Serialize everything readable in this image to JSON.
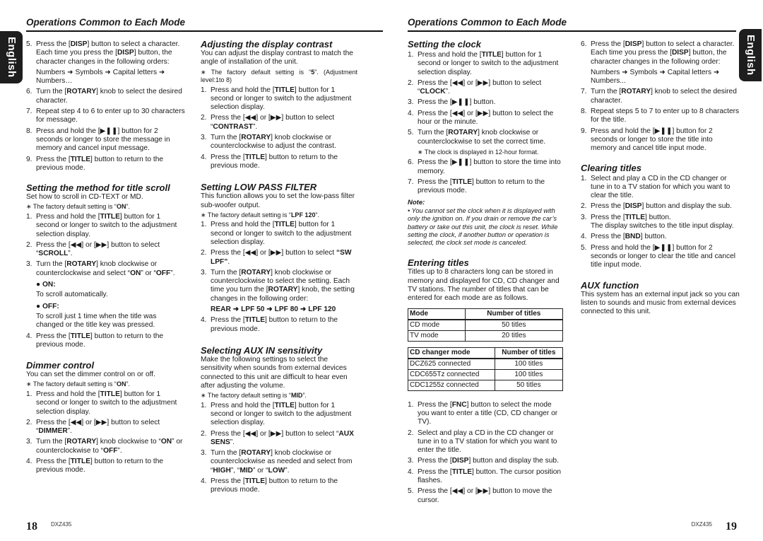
{
  "language_tab": "English",
  "header": {
    "left_title": "Operations Common to Each Mode",
    "right_title": "Operations Common to Each Mode"
  },
  "footer": {
    "left_page": "18",
    "left_model": "DXZ435",
    "right_page": "19",
    "right_model": "DXZ435"
  },
  "col1": {
    "steps_top": [
      {
        "n": "5.",
        "html": "Press the [<b>DISP</b>] button to select a character. Each time you press the [<b>DISP</b>] button, the character changes in the following orders:",
        "sub": "Numbers ➜ Symbols ➜ Capital letters ➜ Numbers…"
      },
      {
        "n": "6.",
        "html": "Turn the [<b>ROTARY</b>] knob to select the desired character."
      },
      {
        "n": "7.",
        "html": "Repeat step 4 to 6 to enter up to 30 characters for message."
      },
      {
        "n": "8.",
        "html": "Press and hold the [▶❚❚] button for 2 seconds or longer to store the message in memory and cancel input message."
      },
      {
        "n": "9.",
        "html": "Press the [<b>TITLE</b>] button to return to the previous mode."
      }
    ],
    "scroll": {
      "title": "Setting the method for title scroll",
      "intro": "Set how to scroll in CD-TEXT or MD.",
      "default_note": "∗ The factory default setting is “<b>ON</b>”.",
      "steps": [
        {
          "n": "1.",
          "html": "Press and hold the [<b>TITLE</b>] button for 1 second or longer to switch to the adjustment selection display."
        },
        {
          "n": "2.",
          "html": "Press the [◀◀] or [▶▶] button to select “<b>SCROLL</b>”."
        },
        {
          "n": "3.",
          "html": "Turn the [<b>ROTARY</b>] knob clockwise or counterclockwise and select “<b>ON</b>” or “<b>OFF</b>”."
        }
      ],
      "on_label": "● ON:",
      "on_text": "To scroll automatically.",
      "off_label": "● OFF:",
      "off_text": "To scroll just 1 time when the title was changed or the title key was pressed.",
      "step4": {
        "n": "4.",
        "html": "Press the [<b>TITLE</b>] button to return to the previous mode."
      }
    },
    "dimmer": {
      "title": "Dimmer control",
      "intro": "You can set the dimmer control on or off.",
      "default_note": "∗ The factory default setting is “<b>ON</b>”.",
      "steps": [
        {
          "n": "1.",
          "html": "Press and hold the [<b>TITLE</b>] button for 1 second or longer to switch to the adjustment selection display."
        },
        {
          "n": "2.",
          "html": "Press the [◀◀] or [▶▶] button to select “<b>DIMMER</b>”."
        },
        {
          "n": "3.",
          "html": "Turn the [<b>ROTARY</b>] knob clockwise to “<b>ON</b>” or counterclockwise to “<b>OFF</b>”."
        },
        {
          "n": "4.",
          "html": "Press the [<b>TITLE</b>] button to return to the previous mode."
        }
      ]
    }
  },
  "col2": {
    "contrast": {
      "title": "Adjusting the display contrast",
      "intro": "You can adjust the display contrast to match the angle of installation of the unit.",
      "default_note": "∗ The factory default setting is “<b>5</b>”. (Adjustment level:1to 8)",
      "steps": [
        {
          "n": "1.",
          "html": "Press and hold the [<b>TITLE</b>] button for 1 second or longer to switch to the adjustment selection display."
        },
        {
          "n": "2.",
          "html": "Press the [◀◀] or [▶▶] button to select “<b>CONTRAST</b>”."
        },
        {
          "n": "3.",
          "html": "Turn the [<b>ROTARY</b>] knob clockwise or counterclockwise to adjust the contrast."
        },
        {
          "n": "4.",
          "html": "Press the [<b>TITLE</b>] button to return to the previous mode."
        }
      ]
    },
    "lpf": {
      "title": "Setting LOW PASS FILTER",
      "intro": "This function allows you to set the low-pass filter sub-woofer output.",
      "default_note": "∗ The factory default setting is “<b>LPF 120</b>”.",
      "steps": [
        {
          "n": "1.",
          "html": "Press and hold the [<b>TITLE</b>] button for 1 second or longer to switch to the adjustment selection display."
        },
        {
          "n": "2.",
          "html": "Press the [◀◀] or [▶▶] button to select <b>“SW LPF”</b>."
        },
        {
          "n": "3.",
          "html": "Turn the [<b>ROTARY</b>] knob clockwise or counterclockwise to select the setting. Each time you turn the [<b>ROTARY</b>] knob, the setting changes in the following order:",
          "sub": "<b>REAR ➜ LPF 50 ➜ LPF 80 ➜ LPF 120</b>"
        },
        {
          "n": "4.",
          "html": "Press the [<b>TITLE</b>] button to return to the previous mode."
        }
      ]
    },
    "aux_sens": {
      "title": "Selecting AUX IN sensitivity",
      "intro": "Make the following settings to select the sensitivity when sounds from external devices connected to this unit are difficult to hear even after adjusting the volume.",
      "default_note": "∗ The factory default setting is “<b>MID</b>”.",
      "steps": [
        {
          "n": "1.",
          "html": "Press and hold the [<b>TITLE</b>] button for 1 second or longer to switch to the adjustment selection display."
        },
        {
          "n": "2.",
          "html": "Press the [◀◀] or [▶▶] button to select “<b>AUX SENS</b>”."
        },
        {
          "n": "3.",
          "html": "Turn the [<b>ROTARY</b>] knob clockwise or counterclockwise as needed and select from “<b>HIGH</b>”, “<b>MID</b>” or “<b>LOW</b>”."
        },
        {
          "n": "4.",
          "html": "Press the [<b>TITLE</b>] button to return to the previous mode."
        }
      ]
    }
  },
  "col3": {
    "clock": {
      "title": "Setting the clock",
      "steps": [
        {
          "n": "1.",
          "html": "Press and hold the [<b>TITLE</b>] button for 1 second or longer to switch to the adjustment selection display."
        },
        {
          "n": "2.",
          "html": "Press the [◀◀] or [▶▶] button to select “<b>CLOCK</b>”."
        },
        {
          "n": "3.",
          "html": "Press the [▶❚❚] button."
        },
        {
          "n": "4.",
          "html": "Press the [◀◀] or [▶▶] button to select the hour or the minute."
        },
        {
          "n": "5.",
          "html": "Turn the [<b>ROTARY</b>] knob clockwise or counterclockwise to set the correct time.",
          "note": "∗ The clock is displayed in 12-hour format."
        },
        {
          "n": "6.",
          "html": "Press the [▶❚❚] button to store the time into memory."
        },
        {
          "n": "7.",
          "html": "Press the [<b>TITLE</b>] button to return to the previous mode."
        }
      ],
      "note_label": "Note:",
      "note_text": "• You cannot set the clock when it is displayed with only the ignition on. If you drain or remove the car’s battery or take out this unit, the clock is reset. While setting the clock, if another button or operation is selected, the clock set mode is canceled."
    },
    "entering": {
      "title": "Entering titles",
      "intro": "Titles up to 8 characters long can be stored in memory and displayed for CD, CD changer and TV stations. The number of titles that can be entered for each mode are as follows.",
      "table1": {
        "headers": [
          "Mode",
          "Number of titles"
        ],
        "rows": [
          [
            "CD mode",
            "50 titles"
          ],
          [
            "TV mode",
            "20 titles"
          ]
        ]
      },
      "table2": {
        "headers": [
          "CD changer mode",
          "Number of titles"
        ],
        "rows": [
          [
            "DCZ625 connected",
            "100 titles"
          ],
          [
            "CDC655Tz connected",
            "100 titles"
          ],
          [
            "CDC1255z connected",
            "50 titles"
          ]
        ]
      },
      "steps": [
        {
          "n": "1.",
          "html": "Press the [<b>FNC</b>] button to select the mode you want to enter a title (CD, CD changer or TV)."
        },
        {
          "n": "2.",
          "html": "Select and play a CD in the CD changer or tune in to a TV station for which you want to enter the title."
        },
        {
          "n": "3.",
          "html": "Press the [<b>DISP</b>] button and display the sub."
        },
        {
          "n": "4.",
          "html": "Press the [<b>TITLE</b>] button. The cursor position flashes."
        },
        {
          "n": "5.",
          "html": "Press the [◀◀] or [▶▶] button to move the cursor."
        }
      ]
    }
  },
  "col4": {
    "steps_top": [
      {
        "n": "6.",
        "html": "Press the [<b>DISP</b>] button to select a character. Each time you press the [<b>DISP</b>] button, the character changes in the following order:",
        "sub": "Numbers ➜ Symbols ➜ Capital letters ➜ Numbers..."
      },
      {
        "n": "7.",
        "html": "Turn the [<b>ROTARY</b>] knob to select the desired character."
      },
      {
        "n": "8.",
        "html": "Repeat steps 5 to 7 to enter up to 8 characters for the title."
      },
      {
        "n": "9.",
        "html": "Press and hold the [▶❚❚] button for 2 seconds or longer to store the title into memory and cancel title input mode."
      }
    ],
    "clearing": {
      "title": "Clearing titles",
      "steps": [
        {
          "n": "1.",
          "html": "Select and play a CD in the CD changer or tune in to a TV station for which you want to clear the title."
        },
        {
          "n": "2.",
          "html": "Press the [<b>DISP</b>] button and display the sub."
        },
        {
          "n": "3.",
          "html": "Press the [<b>TITLE</b>] button.<br>The display switches to the title input display."
        },
        {
          "n": "4.",
          "html": "Press the [<b>BND</b>] button."
        },
        {
          "n": "5.",
          "html": "Press and hold the [▶❚❚] button for 2 seconds or longer to clear the title and cancel title input mode."
        }
      ]
    },
    "aux": {
      "title": "AUX function",
      "text": "This system has an external input jack so you can listen to sounds and music from external devices connected to this unit."
    }
  }
}
